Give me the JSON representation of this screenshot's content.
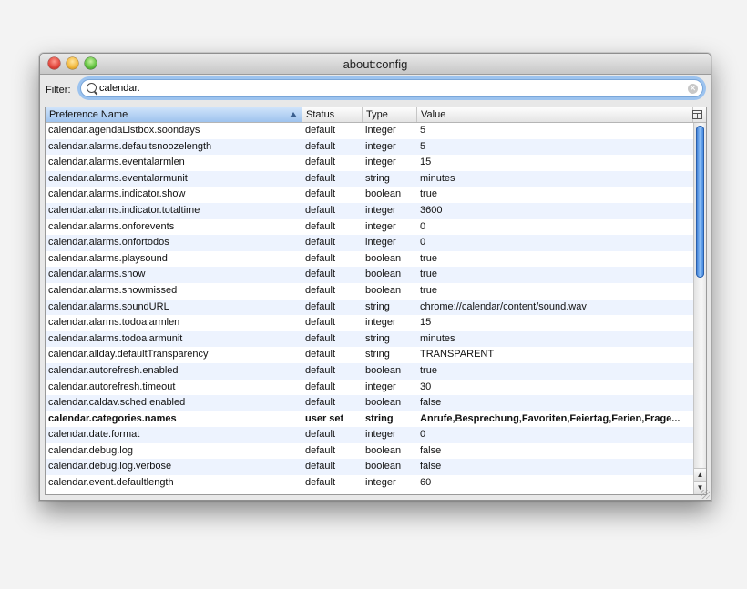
{
  "window": {
    "title": "about:config"
  },
  "filter": {
    "label": "Filter:",
    "value": "calendar."
  },
  "table": {
    "columns": [
      "Preference Name",
      "Status",
      "Type",
      "Value"
    ],
    "sorted_column": "Preference Name",
    "sort_direction": "ascending",
    "rows": [
      {
        "name": "calendar.agendaListbox.soondays",
        "status": "default",
        "type": "integer",
        "value": "5",
        "bold": false
      },
      {
        "name": "calendar.alarms.defaultsnoozelength",
        "status": "default",
        "type": "integer",
        "value": "5",
        "bold": false
      },
      {
        "name": "calendar.alarms.eventalarmlen",
        "status": "default",
        "type": "integer",
        "value": "15",
        "bold": false
      },
      {
        "name": "calendar.alarms.eventalarmunit",
        "status": "default",
        "type": "string",
        "value": "minutes",
        "bold": false
      },
      {
        "name": "calendar.alarms.indicator.show",
        "status": "default",
        "type": "boolean",
        "value": "true",
        "bold": false
      },
      {
        "name": "calendar.alarms.indicator.totaltime",
        "status": "default",
        "type": "integer",
        "value": "3600",
        "bold": false
      },
      {
        "name": "calendar.alarms.onforevents",
        "status": "default",
        "type": "integer",
        "value": "0",
        "bold": false
      },
      {
        "name": "calendar.alarms.onfortodos",
        "status": "default",
        "type": "integer",
        "value": "0",
        "bold": false
      },
      {
        "name": "calendar.alarms.playsound",
        "status": "default",
        "type": "boolean",
        "value": "true",
        "bold": false
      },
      {
        "name": "calendar.alarms.show",
        "status": "default",
        "type": "boolean",
        "value": "true",
        "bold": false
      },
      {
        "name": "calendar.alarms.showmissed",
        "status": "default",
        "type": "boolean",
        "value": "true",
        "bold": false
      },
      {
        "name": "calendar.alarms.soundURL",
        "status": "default",
        "type": "string",
        "value": "chrome://calendar/content/sound.wav",
        "bold": false
      },
      {
        "name": "calendar.alarms.todoalarmlen",
        "status": "default",
        "type": "integer",
        "value": "15",
        "bold": false
      },
      {
        "name": "calendar.alarms.todoalarmunit",
        "status": "default",
        "type": "string",
        "value": "minutes",
        "bold": false
      },
      {
        "name": "calendar.allday.defaultTransparency",
        "status": "default",
        "type": "string",
        "value": "TRANSPARENT",
        "bold": false
      },
      {
        "name": "calendar.autorefresh.enabled",
        "status": "default",
        "type": "boolean",
        "value": "true",
        "bold": false
      },
      {
        "name": "calendar.autorefresh.timeout",
        "status": "default",
        "type": "integer",
        "value": "30",
        "bold": false
      },
      {
        "name": "calendar.caldav.sched.enabled",
        "status": "default",
        "type": "boolean",
        "value": "false",
        "bold": false
      },
      {
        "name": "calendar.categories.names",
        "status": "user set",
        "type": "string",
        "value": "Anrufe,Besprechung,Favoriten,Feiertag,Ferien,Frage...",
        "bold": true
      },
      {
        "name": "calendar.date.format",
        "status": "default",
        "type": "integer",
        "value": "0",
        "bold": false
      },
      {
        "name": "calendar.debug.log",
        "status": "default",
        "type": "boolean",
        "value": "false",
        "bold": false
      },
      {
        "name": "calendar.debug.log.verbose",
        "status": "default",
        "type": "boolean",
        "value": "false",
        "bold": false
      },
      {
        "name": "calendar.event.defaultlength",
        "status": "default",
        "type": "integer",
        "value": "60",
        "bold": false
      }
    ]
  },
  "scrollbar": {
    "position": 0.0,
    "visible_fraction": 0.41
  },
  "colors": {
    "alternate_row": "#edf3fe",
    "focus_ring": "#9cc3ef",
    "scroll_thumb": "#4a8fe0"
  }
}
